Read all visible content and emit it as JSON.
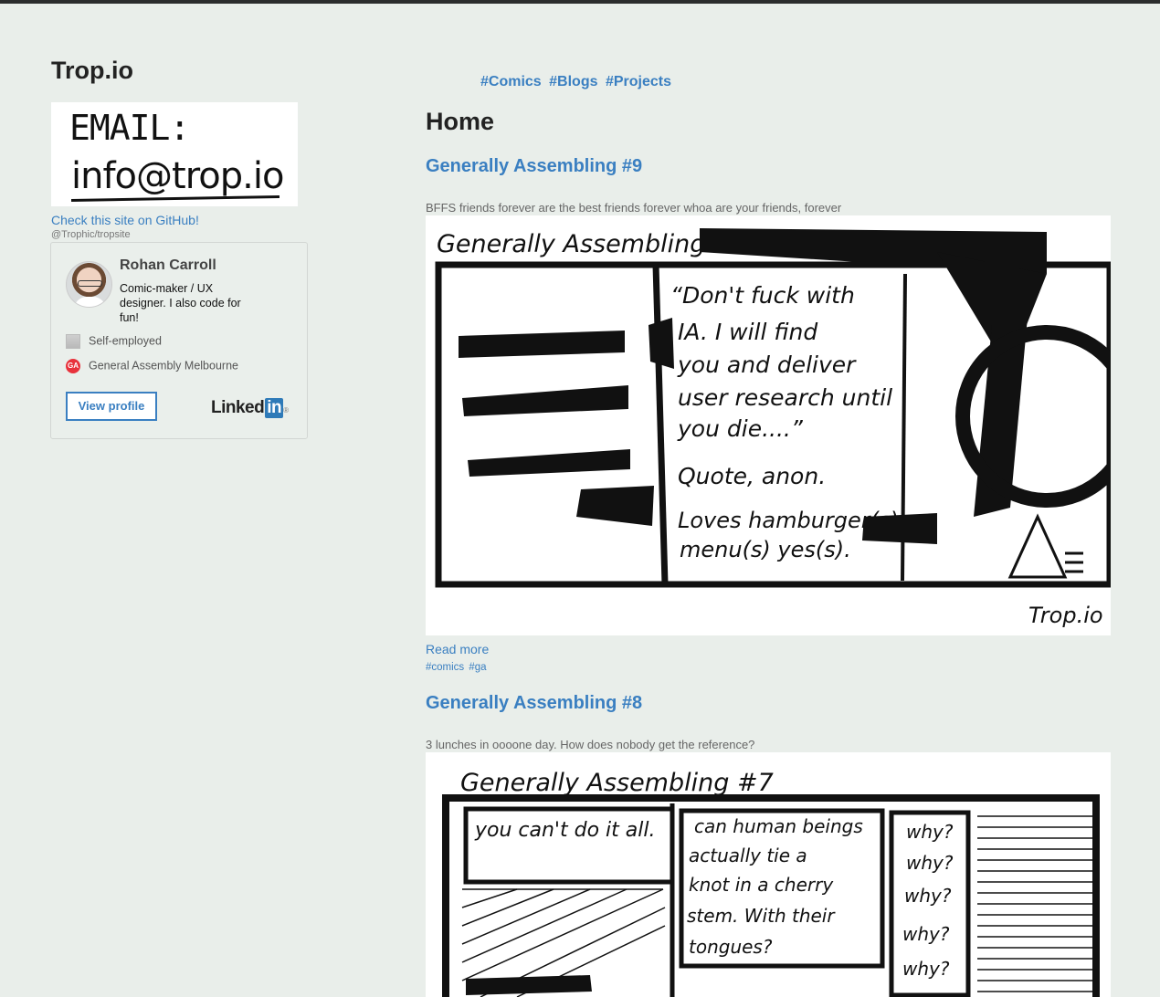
{
  "site": {
    "title": "Trop.io",
    "email_image_line1": "EMAIL:",
    "email_image_line2": "info@trop.io",
    "github_link": "Check this site on GitHub!",
    "github_handle": "@Trophic/tropsite"
  },
  "linkedin": {
    "name": "Rohan Carroll",
    "bio": "Comic-maker / UX designer. I also code for fun!",
    "employer": "Self-employed",
    "school": "General Assembly Melbourne",
    "school_icon": "GA",
    "button": "View profile",
    "logo_text": "Linked",
    "logo_in": "in",
    "logo_reg": "®"
  },
  "nav": {
    "tags": [
      "#Comics",
      "#Blogs",
      "#Projects"
    ]
  },
  "main": {
    "heading": "Home",
    "posts": [
      {
        "title": "Generally Assembling #9",
        "excerpt": "BFFS friends forever are the best friends forever whoa are your friends, forever",
        "comic_text": {
          "title": "Generally Assembling #9",
          "quote1": "“Don't fuck with",
          "quote2": "IA. I will find",
          "quote3": "you and deliver",
          "quote4": "user research until",
          "quote5": "you die....”",
          "quote6": "Quote, anon.",
          "quote7": "Loves hamburger(s)",
          "quote8": "menu(s) yes(s).",
          "signature": "Trop.io"
        },
        "read_more": "Read more",
        "tags": [
          "#comics",
          "#ga"
        ]
      },
      {
        "title": "Generally Assembling #8",
        "excerpt": "3 lunches in oooone day. How does nobody get the reference?",
        "comic_text": {
          "title": "Generally Assembling #7",
          "panel1": "you can't do it all.",
          "panel2_l1": "can human beings",
          "panel2_l2": "actually tie a",
          "panel2_l3": "knot in a cherry",
          "panel2_l4": "stem. With their",
          "panel2_l5": "tongues?",
          "panel3": [
            "why?",
            "why?",
            "why?",
            "why?",
            "why?"
          ]
        }
      }
    ]
  },
  "icons": {
    "building": "building-icon",
    "ga": "ga-logo-icon"
  },
  "colors": {
    "background": "#e9eeea",
    "link": "#3a7fc1",
    "topbar": "#2b2d2d"
  }
}
